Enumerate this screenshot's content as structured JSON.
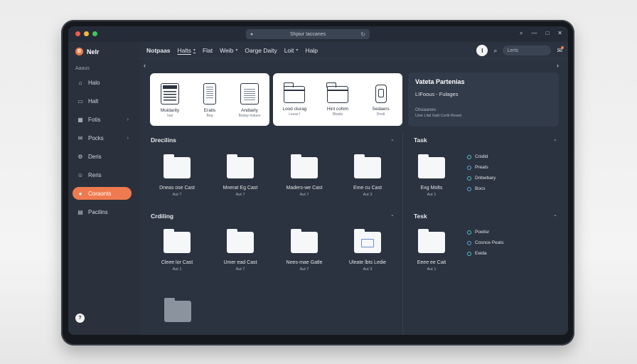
{
  "window": {
    "address": "Shpiur Iaccanes",
    "controls": [
      "search-icon",
      "minimize-icon",
      "restore-icon",
      "close-icon"
    ],
    "traffic_light_colors": [
      "#f05a4f",
      "#f5b83d",
      "#3fc85a"
    ]
  },
  "sidebar": {
    "brand": "Nelr",
    "brand_initial": "B",
    "section": "Aaaus",
    "help_label": "?",
    "items": [
      {
        "label": "Halo",
        "icon": "home-icon",
        "glyph": "⌂",
        "chevron": false,
        "active": false
      },
      {
        "label": "Halt",
        "icon": "window-icon",
        "glyph": "▭",
        "chevron": false,
        "active": false
      },
      {
        "label": "Fotis",
        "icon": "grid-icon",
        "glyph": "▦",
        "chevron": true,
        "active": false
      },
      {
        "label": "Pocks",
        "icon": "mail-icon",
        "glyph": "✉",
        "chevron": true,
        "active": false
      },
      {
        "label": "Deris",
        "icon": "settings-icon",
        "glyph": "⚙",
        "chevron": false,
        "active": false
      },
      {
        "label": "Reris",
        "icon": "user-icon",
        "glyph": "☺",
        "chevron": false,
        "active": false
      },
      {
        "label": "Coraonts",
        "icon": "flame-icon",
        "glyph": "●",
        "chevron": false,
        "active": true
      },
      {
        "label": "Pacilins",
        "icon": "file-icon",
        "glyph": "▤",
        "chevron": false,
        "active": false
      }
    ]
  },
  "menubar": {
    "items": [
      {
        "label": "Notpaas",
        "caret": false
      },
      {
        "label": "Halts",
        "caret": true
      },
      {
        "label": "Flat",
        "caret": false
      },
      {
        "label": "Weib",
        "caret": true
      },
      {
        "label": "Oarge Daity",
        "caret": false
      },
      {
        "label": "Loit",
        "caret": true
      },
      {
        "label": "Halp",
        "caret": false
      }
    ],
    "avatar_label": "I",
    "search_placeholder": "Lerts"
  },
  "cards": {
    "left": [
      {
        "label": "Muidarity",
        "sub": "Isal",
        "icon": "spreadsheet-icon"
      },
      {
        "label": "Eratis",
        "sub": "Beg",
        "icon": "mobile-doc-icon"
      },
      {
        "label": "Andiarty",
        "sub": "Boday-Indues",
        "icon": "document-icon"
      }
    ],
    "right": [
      {
        "label": "Lood clurag",
        "sub": "Lsuse I",
        "icon": "folder-outline-icon"
      },
      {
        "label": "Hinl cohim",
        "sub": "Bbads",
        "icon": "folder-outline-icon"
      },
      {
        "label": "Sedaers",
        "sub": "Dnolt",
        "icon": "phone-icon"
      }
    ]
  },
  "info_panel": {
    "title": "Vateta Partenias",
    "subtitle": "LIFoous - Fulages",
    "line1": "Otsiaanes",
    "line2": "Usie Lilal Gatt Cerlii Rewel"
  },
  "sections": {
    "s1": {
      "title": "Drecilins"
    },
    "s2": {
      "title": "Crdiling"
    },
    "t1": {
      "title": "Task"
    },
    "t2": {
      "title": "Tesk"
    }
  },
  "folders_row1": [
    {
      "label": "Dneas ose Cast",
      "sub": "Aut 7"
    },
    {
      "label": "Mnerat Eg Cast",
      "sub": "Aut 7"
    },
    {
      "label": "Maders-we Cast",
      "sub": "Aut 7"
    },
    {
      "label": "Eme cu Cast",
      "sub": "Aut 3"
    }
  ],
  "folders_row2": [
    {
      "label": "Cleee lor Cast",
      "sub": "Aut 1"
    },
    {
      "label": "Umer ead Cast",
      "sub": "Aut 7"
    },
    {
      "label": "Nees-mae Gatle",
      "sub": "Aut 7"
    },
    {
      "label": "Uleate lbts Ledie",
      "sub": "Aut 3"
    }
  ],
  "task_folder1": {
    "label": "Exg Molts",
    "sub": "Aut 1"
  },
  "task_folder2": {
    "label": "Eeee ee Cait",
    "sub": "Aut 1"
  },
  "tasks1": [
    "Cnidld",
    "Preats",
    "Dnbwbary",
    "Bocs"
  ],
  "tasks2": [
    "Poetisr",
    "Cosnce Peats",
    "Eeida"
  ]
}
